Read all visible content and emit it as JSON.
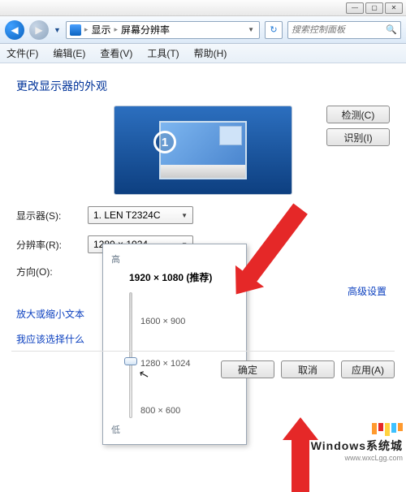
{
  "titlebar": {
    "min": "—",
    "max": "▢",
    "close": "✕"
  },
  "nav": {
    "path_root": "显示",
    "path_leaf": "屏幕分辨率",
    "search_placeholder": "搜索控制面板"
  },
  "menu": {
    "file": "文件(F)",
    "edit": "编辑(E)",
    "view": "查看(V)",
    "tools": "工具(T)",
    "help": "帮助(H)"
  },
  "page": {
    "title": "更改显示器的外观",
    "detect_btn": "检测(C)",
    "identify_btn": "识别(I)",
    "monitor_number": "1"
  },
  "form": {
    "display_label": "显示器(S):",
    "display_value": "1. LEN T2324C",
    "res_label": "分辨率(R):",
    "res_value": "1280 × 1024",
    "orient_label": "方向(O):"
  },
  "dropdown": {
    "high": "高",
    "low": "低",
    "recommended": "1920 × 1080 (推荐)",
    "t1": "1600 × 900",
    "t2": "1280 × 1024",
    "t3": "800 × 600"
  },
  "links": {
    "l1": "放大或缩小文本",
    "l2": "我应该选择什么",
    "adv": "高级设置"
  },
  "buttons": {
    "ok": "确定",
    "cancel": "取消",
    "apply": "应用(A)"
  },
  "watermark": {
    "title": "Windows系统城",
    "url": "www.wxcLgg.com"
  }
}
